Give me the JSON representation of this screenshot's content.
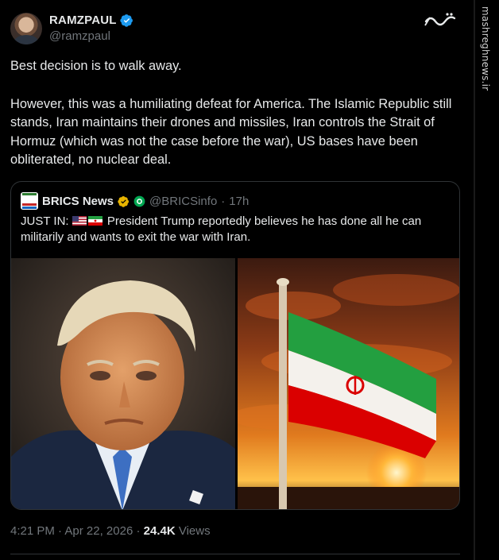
{
  "author": {
    "name": "RAMZPAUL",
    "handle": "@ramzpaul",
    "verified_icon": "verified-badge-icon"
  },
  "tweet": {
    "paragraph_1": "Best decision is to walk away.",
    "paragraph_2": "However, this was a humiliating defeat for America. The Islamic Republic still stands, Iran maintains their drones and missiles, Iran controls the Strait of Hormuz (which was not the case before the war), US bases have been obliterated, no nuclear deal."
  },
  "quoted": {
    "name": "BRICS News",
    "handle": "@BRICSinfo",
    "time": "17h",
    "separator": "·",
    "prefix": "JUST IN:",
    "text": "President Trump reportedly believes he has done all he can militarily and wants to exit the war with Iran."
  },
  "meta": {
    "time": "4:21 PM",
    "date": "Apr 22, 2026",
    "views_count": "24.4K",
    "views_label": "Views"
  },
  "watermark": {
    "site": "mashreghnews.ir"
  },
  "colors": {
    "background": "#000000",
    "text": "#e7e9ea",
    "muted": "#71767b",
    "border": "#2f3336",
    "verified_blue": "#1d9bf0",
    "verified_gold": "#e8b400"
  }
}
